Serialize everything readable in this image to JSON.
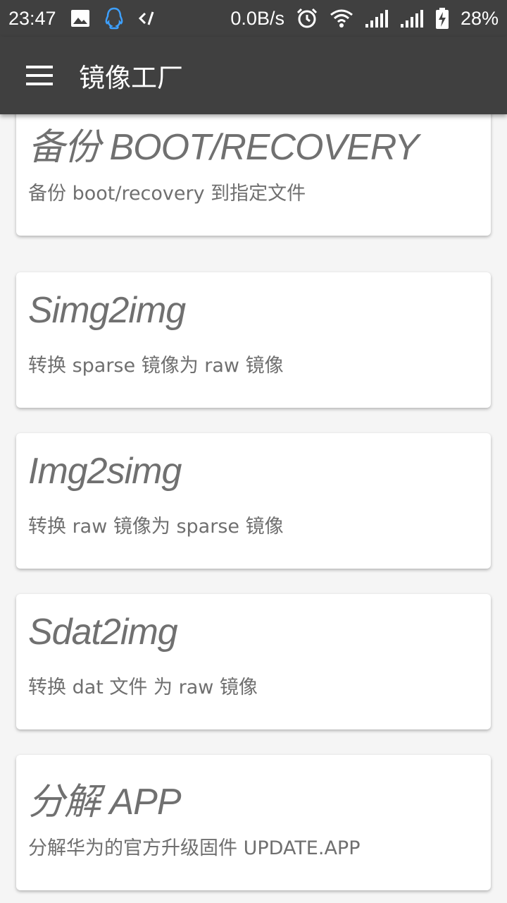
{
  "status_bar": {
    "time": "23:47",
    "net_speed": "0.0B/s",
    "battery": "28%",
    "icons": [
      "image-icon",
      "qq-icon",
      "code-icon",
      "alarm-icon",
      "wifi-icon",
      "signal-icon",
      "signal-icon",
      "battery-charging-icon"
    ]
  },
  "app_bar": {
    "title": "镜像工厂",
    "menu_icon": "menu-icon"
  },
  "colors": {
    "app_bar": "#404040",
    "background": "#f5f5f5",
    "card": "#ffffff",
    "text": "#707070"
  },
  "cards": [
    {
      "title": "备份 BOOT/RECOVERY",
      "description": "备份 boot/recovery 到指定文件"
    },
    {
      "title": "Simg2img",
      "description": "转换 sparse 镜像为 raw 镜像"
    },
    {
      "title": "Img2simg",
      "description": "转换 raw 镜像为 sparse 镜像"
    },
    {
      "title": "Sdat2img",
      "description": "转换 dat 文件 为 raw 镜像"
    },
    {
      "title": "分解 APP",
      "description": "分解华为的官方升级固件 UPDATE.APP"
    }
  ]
}
